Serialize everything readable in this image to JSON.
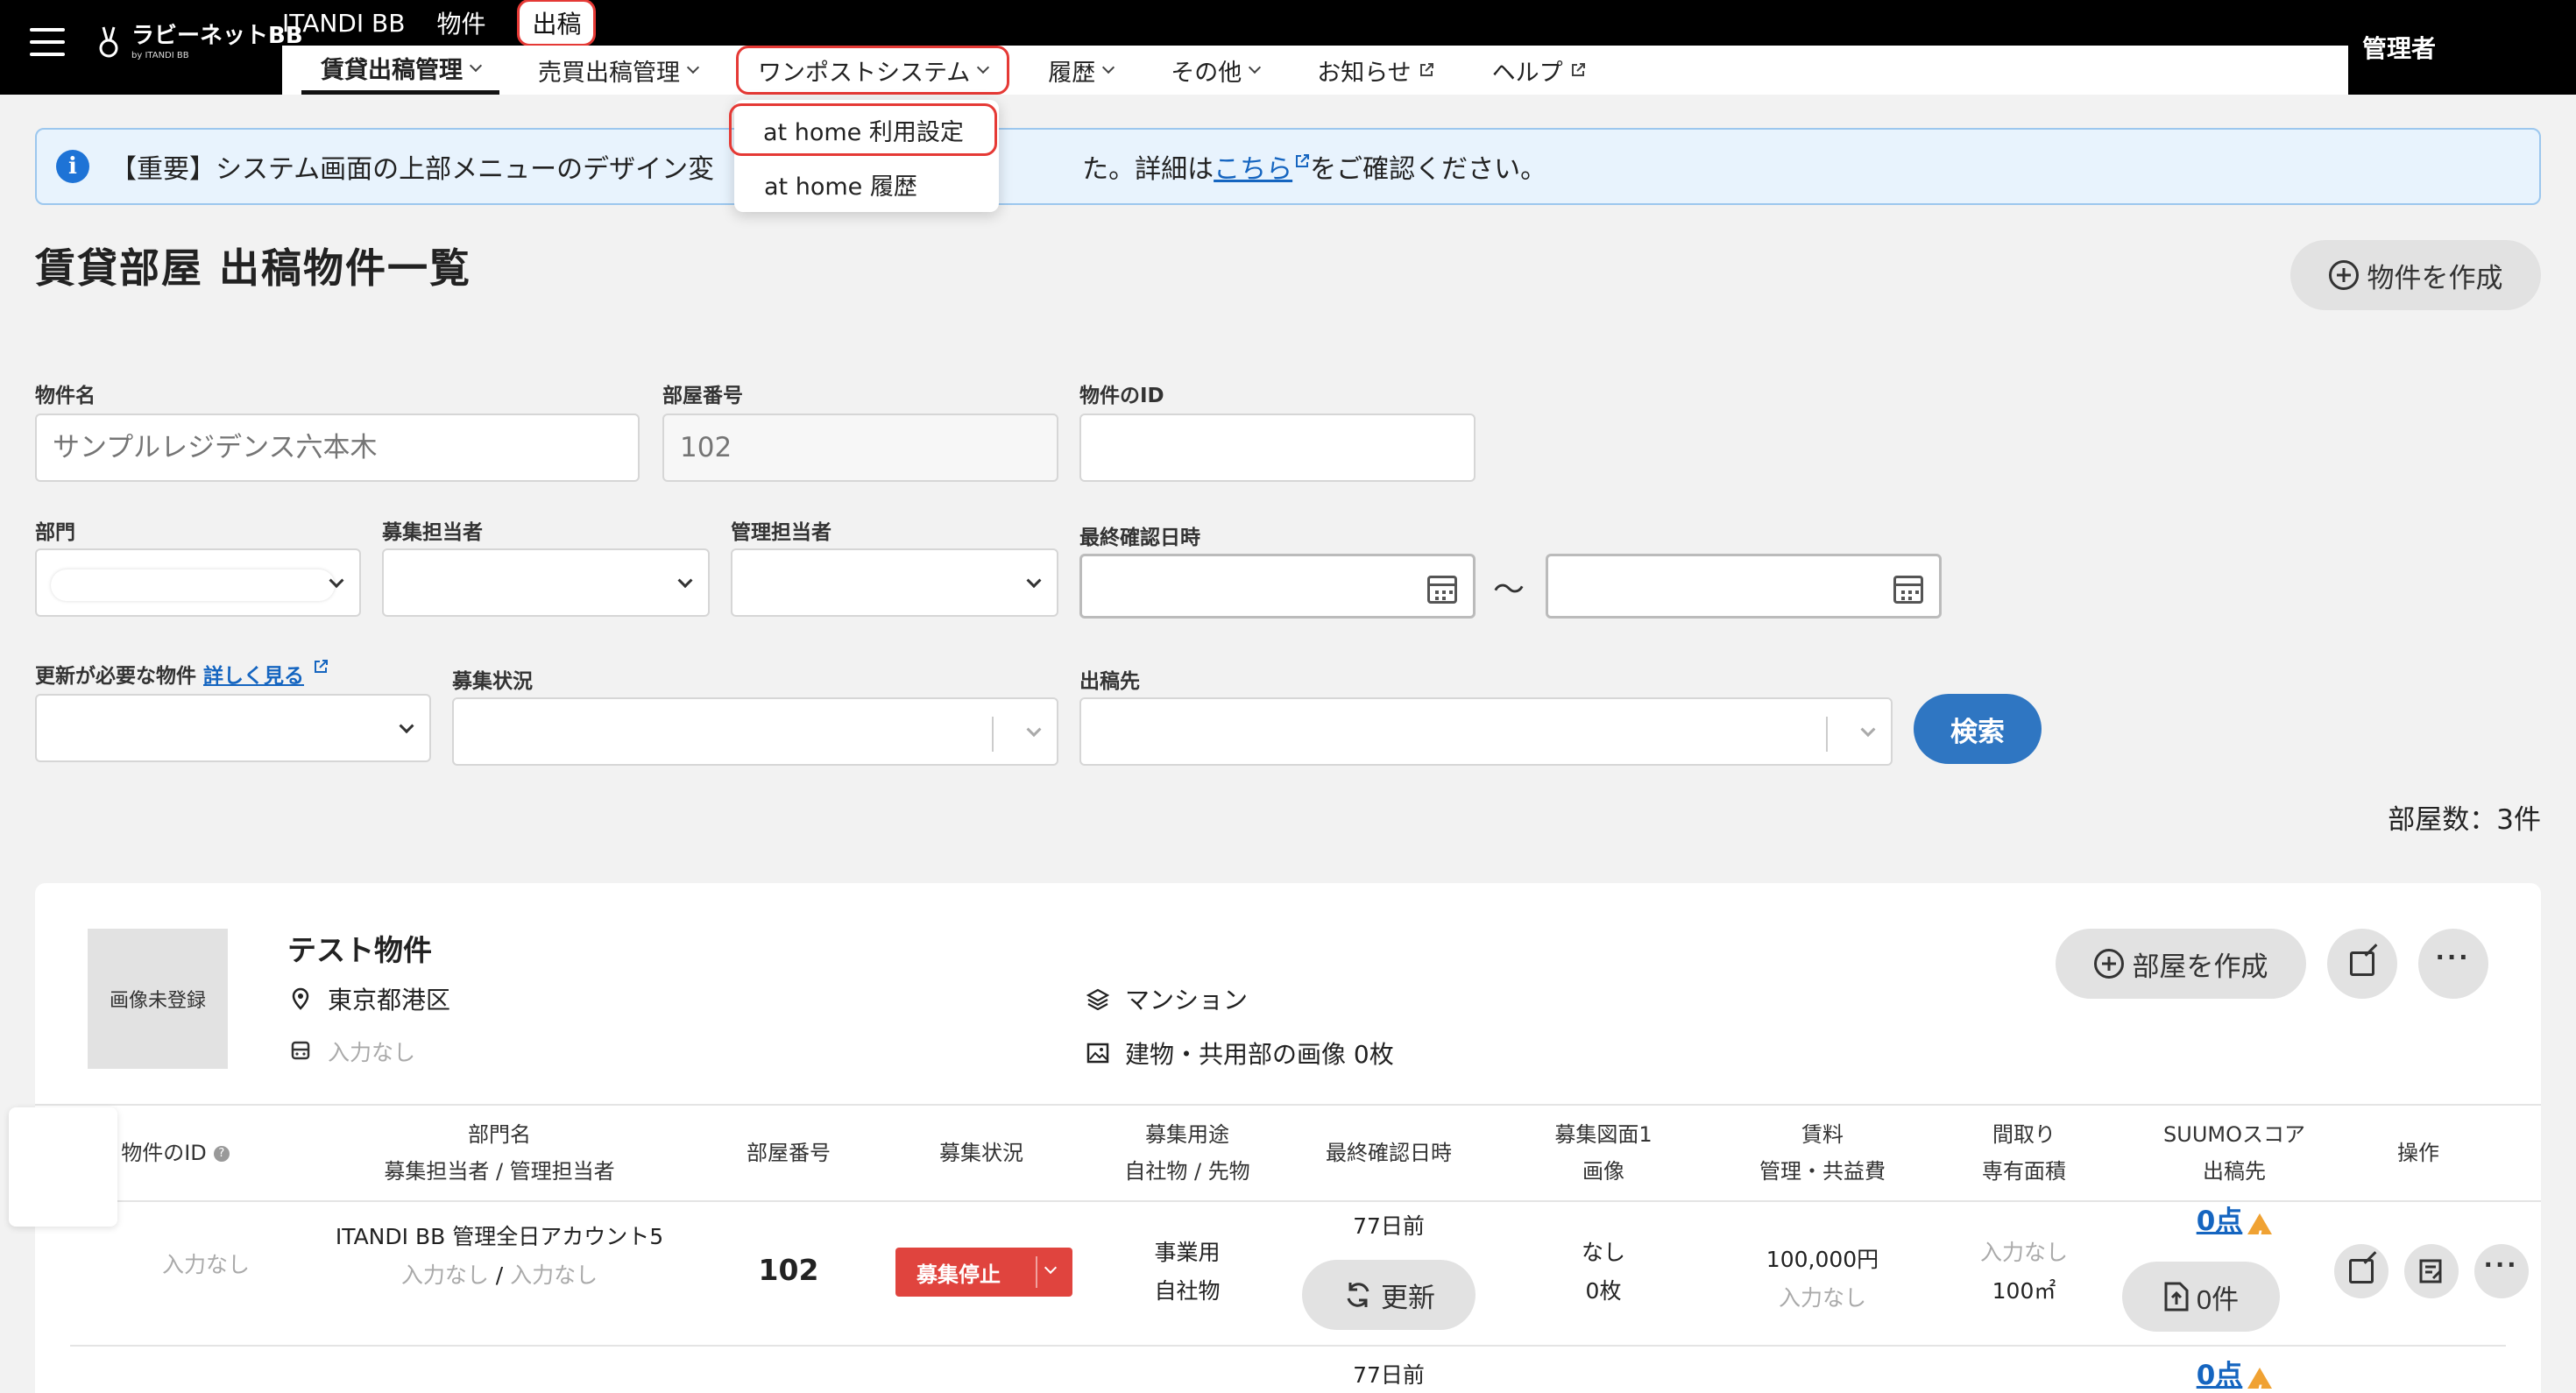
{
  "header": {
    "logo_text": "ラビーネットBB",
    "logo_sub": "by ITANDI BB",
    "top_tabs": [
      "ITANDI BB",
      "物件",
      "出稿"
    ],
    "subnav": [
      {
        "label": "賃貸出稿管理"
      },
      {
        "label": "売買出稿管理"
      },
      {
        "label": "ワンポストシステム"
      },
      {
        "label": "履歴"
      },
      {
        "label": "その他"
      },
      {
        "label": "お知らせ"
      },
      {
        "label": "ヘルプ"
      }
    ],
    "admin_label": "管理者"
  },
  "dropdown": {
    "items": [
      "at home 利用設定",
      "at home 履歴"
    ]
  },
  "notice": {
    "text_before": "【重要】システム画面の上部メニューのデザイン変",
    "text_mid": "た。詳細は",
    "link": "こちら",
    "text_after": "をご確認ください。"
  },
  "page": {
    "title": "賃貸部屋 出稿物件一覧",
    "create_property": "物件を作成"
  },
  "form": {
    "property_name": {
      "label": "物件名",
      "placeholder": "サンプルレジデンス六本木"
    },
    "room_number": {
      "label": "部屋番号",
      "placeholder": "102"
    },
    "property_id": {
      "label": "物件のID"
    },
    "department": {
      "label": "部門"
    },
    "recruiter": {
      "label": "募集担当者"
    },
    "manager": {
      "label": "管理担当者"
    },
    "last_confirmed": {
      "label": "最終確認日時",
      "separator": "〜"
    },
    "needs_update": {
      "label": "更新が必要な物件",
      "link": "詳しく見る"
    },
    "recruit_status": {
      "label": "募集状況"
    },
    "destination": {
      "label": "出稿先"
    },
    "search_button": "検索"
  },
  "room_count": "部屋数：3件",
  "property": {
    "thumbnail": "画像未登録",
    "name": "テスト物件",
    "location": "東京都港区",
    "station": "入力なし",
    "type": "マンション",
    "images": "建物・共用部の画像 0枚",
    "create_room": "部屋を作成"
  },
  "table": {
    "headers": [
      {
        "l1": "物件のID",
        "l2": ""
      },
      {
        "l1": "部門名",
        "l2": "募集担当者 / 管理担当者"
      },
      {
        "l1": "部屋番号",
        "l2": ""
      },
      {
        "l1": "募集状況",
        "l2": ""
      },
      {
        "l1": "募集用途",
        "l2": "自社物 / 先物"
      },
      {
        "l1": "最終確認日時",
        "l2": ""
      },
      {
        "l1": "募集図面1",
        "l2": "画像"
      },
      {
        "l1": "賃料",
        "l2": "管理・共益費"
      },
      {
        "l1": "間取り",
        "l2": "専有面積"
      },
      {
        "l1": "SUUMOスコア",
        "l2": "出稿先"
      },
      {
        "l1": "操作",
        "l2": ""
      }
    ],
    "rows": [
      {
        "property_id": "入力なし",
        "dept": "ITANDI BB 管理全日アカウント5",
        "staff_a": "入力なし",
        "staff_sep": "/",
        "staff_b": "入力なし",
        "room": "102",
        "status": "募集停止",
        "usage": "事業用",
        "ownership": "自社物",
        "confirmed": "77日前",
        "update_button": "更新",
        "plan": "なし",
        "images": "0枚",
        "rent": "100,000円",
        "fee": "入力なし",
        "layout": "入力なし",
        "area": "100㎡",
        "score": "0点",
        "destinations": "0件"
      },
      {
        "confirmed": "77日前",
        "score": "0点"
      }
    ]
  }
}
